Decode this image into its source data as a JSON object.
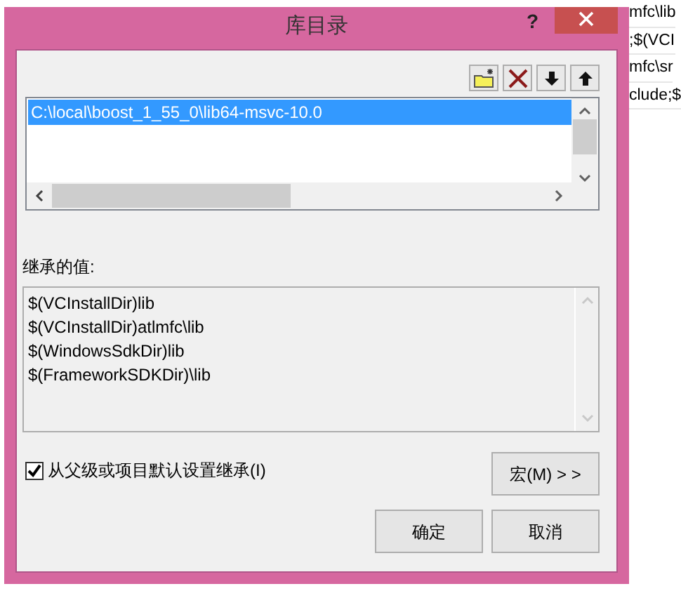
{
  "background_window": {
    "column_3": [
      "mfc\\lib",
      ";$(VCI",
      "mfc\\sr",
      "clude;$"
    ]
  },
  "dialog": {
    "title": "库目录",
    "help": "?",
    "toolbar": [
      {
        "kind": "new-folder"
      },
      {
        "kind": "delete"
      },
      {
        "kind": "down"
      },
      {
        "kind": "up"
      }
    ],
    "directories": [
      {
        "text": "C:\\local\\boost_1_55_0\\lib64-msvc-10.0",
        "selected": true
      }
    ],
    "inherited_label": "继承的值:",
    "inherited_values": [
      "$(VCInstallDir)lib",
      "$(VCInstallDir)atlmfc\\lib",
      "$(WindowsSdkDir)lib",
      "$(FrameworkSDKDir)\\lib"
    ],
    "inherit_checkbox": {
      "label": "从父级或项目默认设置继承(I)",
      "checked": true
    },
    "buttons": [
      {
        "kind": "macros",
        "label": "宏(M) > >"
      },
      {
        "kind": "ok",
        "label": "确定"
      },
      {
        "kind": "cancel",
        "label": "取消"
      }
    ]
  }
}
